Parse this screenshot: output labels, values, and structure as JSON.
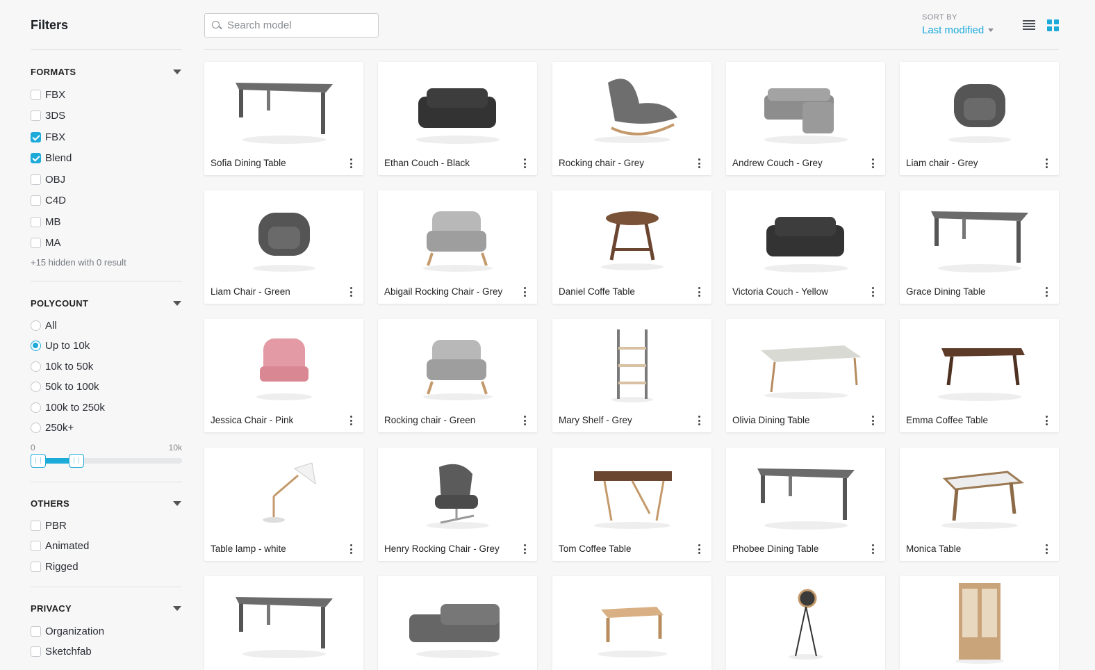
{
  "sidebar": {
    "title": "Filters",
    "formats": {
      "heading": "FORMATS",
      "options": [
        {
          "label": "FBX",
          "checked": false
        },
        {
          "label": "3DS",
          "checked": false
        },
        {
          "label": "FBX",
          "checked": true
        },
        {
          "label": "Blend",
          "checked": true
        },
        {
          "label": "OBJ",
          "checked": false
        },
        {
          "label": "C4D",
          "checked": false
        },
        {
          "label": "MB",
          "checked": false
        },
        {
          "label": "MA",
          "checked": false
        }
      ],
      "hidden_note": "+15 hidden with 0 result"
    },
    "polycount": {
      "heading": "POLYCOUNT",
      "options": [
        {
          "label": "All",
          "selected": false
        },
        {
          "label": "Up to 10k",
          "selected": true
        },
        {
          "label": "10k to 50k",
          "selected": false
        },
        {
          "label": "50k to 100k",
          "selected": false
        },
        {
          "label": "100k to 250k",
          "selected": false
        },
        {
          "label": "250k+",
          "selected": false
        }
      ],
      "range_min_label": "0",
      "range_max_label": "10k"
    },
    "others": {
      "heading": "OTHERS",
      "options": [
        {
          "label": "PBR",
          "checked": false
        },
        {
          "label": "Animated",
          "checked": false
        },
        {
          "label": "Rigged",
          "checked": false
        }
      ]
    },
    "privacy": {
      "heading": "PRIVACY",
      "options": [
        {
          "label": "Organization",
          "checked": false
        },
        {
          "label": "Sketchfab",
          "checked": false
        }
      ]
    }
  },
  "search": {
    "placeholder": "Search model",
    "value": ""
  },
  "sort": {
    "label": "SORT BY",
    "value": "Last modified"
  },
  "colors": {
    "accent": "#1caad9",
    "background": "#f7f7f8",
    "card": "#ffffff"
  },
  "models": [
    {
      "name": "Sofia Dining Table",
      "icon": "dining-table-icon"
    },
    {
      "name": "Ethan Couch - Black",
      "icon": "couch-icon"
    },
    {
      "name": "Rocking chair - Grey",
      "icon": "rocking-chair-icon"
    },
    {
      "name": "Andrew Couch - Grey",
      "icon": "sectional-couch-icon"
    },
    {
      "name": "Liam chair - Grey",
      "icon": "armchair-icon"
    },
    {
      "name": "Liam Chair - Green",
      "icon": "armchair-icon"
    },
    {
      "name": "Abigail Rocking Chair - Grey",
      "icon": "lounge-chair-icon"
    },
    {
      "name": "Daniel Coffe Table",
      "icon": "round-table-icon"
    },
    {
      "name": "Victoria Couch - Yellow",
      "icon": "couch-icon"
    },
    {
      "name": "Grace Dining Table",
      "icon": "dining-table-icon"
    },
    {
      "name": "Jessica Chair - Pink",
      "icon": "tufted-chair-icon"
    },
    {
      "name": "Rocking chair - Green",
      "icon": "lounge-chair-icon"
    },
    {
      "name": "Mary Shelf - Grey",
      "icon": "shelf-icon"
    },
    {
      "name": "Olivia Dining Table",
      "icon": "dining-set-icon"
    },
    {
      "name": "Emma Coffee Table",
      "icon": "trestle-table-icon"
    },
    {
      "name": "Table lamp - white",
      "icon": "desk-lamp-icon"
    },
    {
      "name": "Henry Rocking Chair - Grey",
      "icon": "swivel-chair-icon"
    },
    {
      "name": "Tom Coffee Table",
      "icon": "desk-icon"
    },
    {
      "name": "Phobee Dining Table",
      "icon": "dining-table-icon"
    },
    {
      "name": "Monica Table",
      "icon": "table-icon"
    },
    {
      "name": "",
      "icon": "dining-table-icon"
    },
    {
      "name": "",
      "icon": "modular-sofa-icon"
    },
    {
      "name": "",
      "icon": "bench-table-icon"
    },
    {
      "name": "",
      "icon": "floor-lamp-icon"
    },
    {
      "name": "",
      "icon": "cabinet-icon"
    }
  ]
}
